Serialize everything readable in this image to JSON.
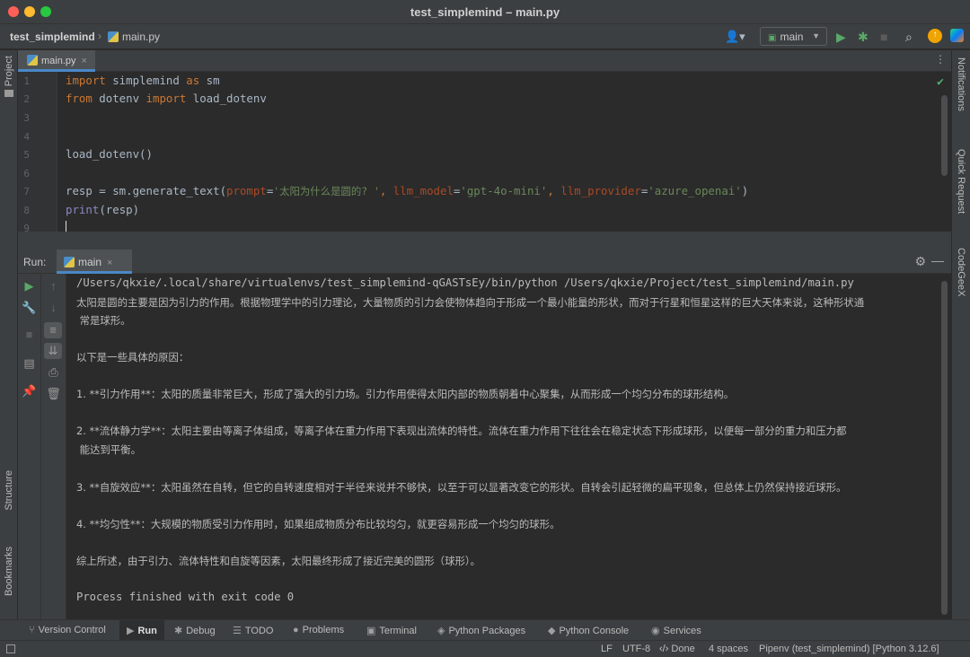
{
  "window": {
    "title": "test_simplemind – main.py"
  },
  "nav": {
    "project": "test_simplemind",
    "file": "main.py",
    "run_config": "main"
  },
  "sidebars": {
    "left_top": "Project",
    "left_structure": "Structure",
    "left_bookmarks": "Bookmarks",
    "right_notifications": "Notifications",
    "right_quick_request": "Quick Request",
    "right_codegeex": "CodeGeeX"
  },
  "editor": {
    "tab": "main.py",
    "line_numbers": [
      "1",
      "2",
      "3",
      "4",
      "5",
      "6",
      "7",
      "8",
      "9"
    ],
    "lines": {
      "l1_kw1": "import",
      "l1_mid": " simplemind ",
      "l1_kw2": "as",
      "l1_end": " sm",
      "l2_kw1": "from",
      "l2_mid": " dotenv ",
      "l2_kw2": "import",
      "l2_end": " load_dotenv",
      "l5": "load_dotenv()",
      "l7_a": "resp = sm.generate_text(",
      "l7_p1": "prompt",
      "l7_eq1": "=",
      "l7_s1": "'太阳为什么是圆的? '",
      "l7_c1": ", ",
      "l7_p2": "llm_model",
      "l7_eq2": "=",
      "l7_s2": "'gpt-4o-mini'",
      "l7_c2": ", ",
      "l7_p3": "llm_provider",
      "l7_eq3": "=",
      "l7_s3": "'azure_openai'",
      "l7_end": ")",
      "l8_fn": "print",
      "l8_rest": "(resp)"
    }
  },
  "run": {
    "label": "Run:",
    "tab": "main",
    "console": [
      "/Users/qkxie/.local/share/virtualenvs/test_simplemind-qGASTsEy/bin/python /Users/qkxie/Project/test_simplemind/main.py",
      "太阳是圆的主要是因为引力的作用。根据物理学中的引力理论，大量物质的引力会使物体趋向于形成一个最小能量的形状，而对于行星和恒星这样的巨大天体来说，这种形状通",
      " 常是球形。",
      "以下是一些具体的原因：",
      "1. **引力作用**：太阳的质量非常巨大，形成了强大的引力场。引力作用使得太阳内部的物质朝着中心聚集，从而形成一个均匀分布的球形结构。",
      "2. **流体静力学**：太阳主要由等离子体组成，等离子体在重力作用下表现出流体的特性。流体在重力作用下往往会在稳定状态下形成球形，以便每一部分的重力和压力都",
      " 能达到平衡。",
      "3. **自旋效应**：太阳虽然在自转，但它的自转速度相对于半径来说并不够快，以至于可以显著改变它的形状。自转会引起轻微的扁平现象，但总体上仍然保持接近球形。",
      "4. **均匀性**：大规模的物质受引力作用时，如果组成物质分布比较均匀，就更容易形成一个均匀的球形。",
      "综上所述，由于引力、流体特性和自旋等因素，太阳最终形成了接近完美的圆形（球形）。",
      "Process finished with exit code 0"
    ]
  },
  "bottom_tools": {
    "version_control": "Version Control",
    "run": "Run",
    "debug": "Debug",
    "todo": "TODO",
    "problems": "Problems",
    "terminal": "Terminal",
    "python_packages": "Python Packages",
    "python_console": "Python Console",
    "services": "Services"
  },
  "status": {
    "line_sep": "LF",
    "encoding": "UTF-8",
    "done": "Done",
    "indent": "4 spaces",
    "interpreter": "Pipenv (test_simplemind) [Python 3.12.6]"
  },
  "colors": {
    "accent": "#4a88c7",
    "keyword": "#cc7832",
    "string": "#6a8759",
    "param": "#aa4926",
    "run_green": "#59a869"
  },
  "icons": [
    "project-icon",
    "user-icon",
    "run-icon",
    "debug-icon",
    "stop-icon",
    "search-icon",
    "update-icon",
    "jetbrains-icon",
    "gear-icon",
    "minimize-icon",
    "check-icon"
  ]
}
